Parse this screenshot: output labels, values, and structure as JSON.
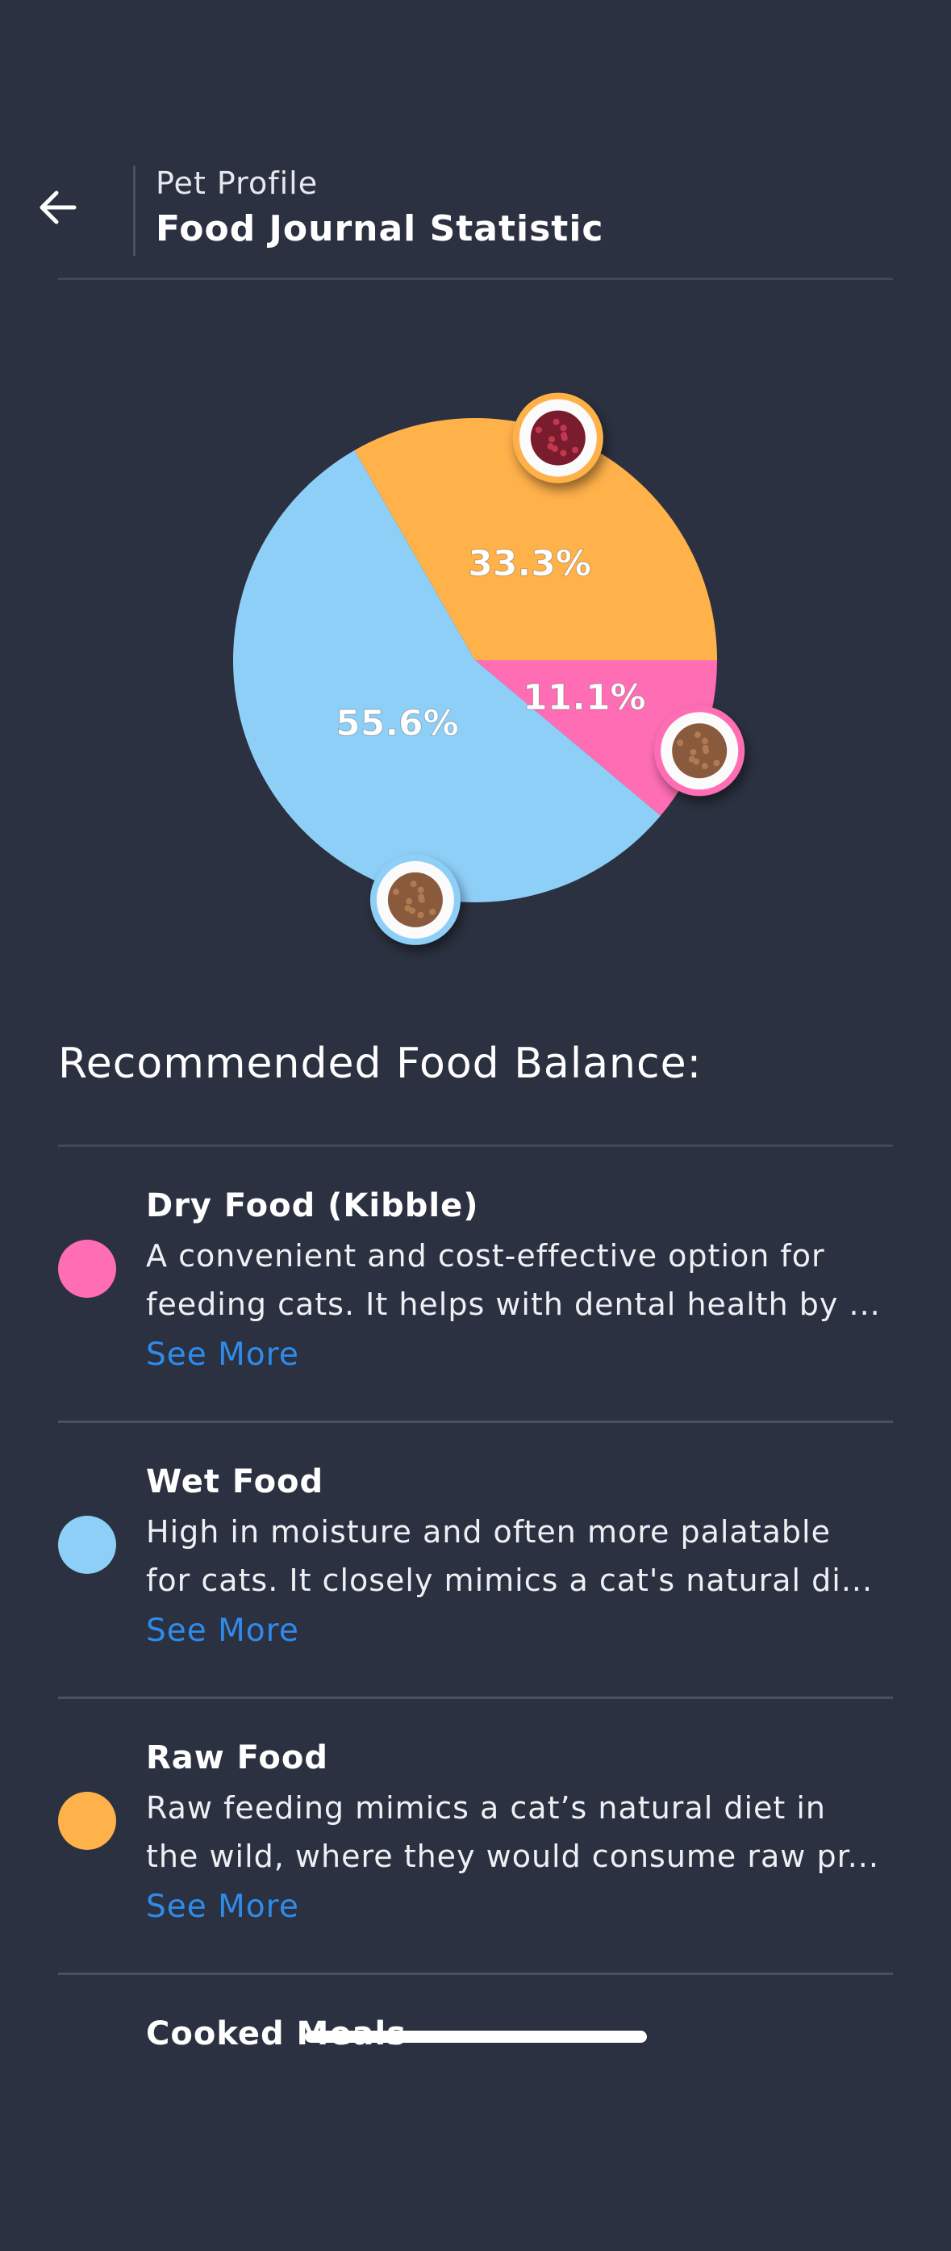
{
  "header": {
    "subtitle": "Pet Profile",
    "title": "Food Journal Statistic"
  },
  "chart_data": {
    "type": "pie",
    "categories": [
      "Dry Food (Kibble)",
      "Wet Food",
      "Raw Food"
    ],
    "values": [
      11.1,
      55.6,
      33.3
    ],
    "labels": [
      "11.1%",
      "55.6%",
      "33.3%"
    ],
    "colors": [
      "#ff6eb4",
      "#8ecff8",
      "#ffb14a"
    ],
    "start_angle_deg": 0,
    "direction": "clockwise"
  },
  "section": {
    "title": "Recommended Food Balance:"
  },
  "food_items": [
    {
      "name": "Dry Food (Kibble)",
      "line1": "A convenient and cost-effective option for",
      "line2": "feeding cats. It helps with dental health by ...",
      "more": "See More",
      "color": "#ff6eb4"
    },
    {
      "name": "Wet Food",
      "line1": "High in moisture and often more palatable",
      "line2": "for cats. It closely mimics a cat's natural di...",
      "more": "See More",
      "color": "#8ecff8"
    },
    {
      "name": "Raw Food",
      "line1": "Raw feeding mimics a cat’s natural diet in",
      "line2": "the wild, where they would consume raw pr...",
      "more": "See More",
      "color": "#ffb14a"
    },
    {
      "name": "Cooked Meals"
    }
  ]
}
